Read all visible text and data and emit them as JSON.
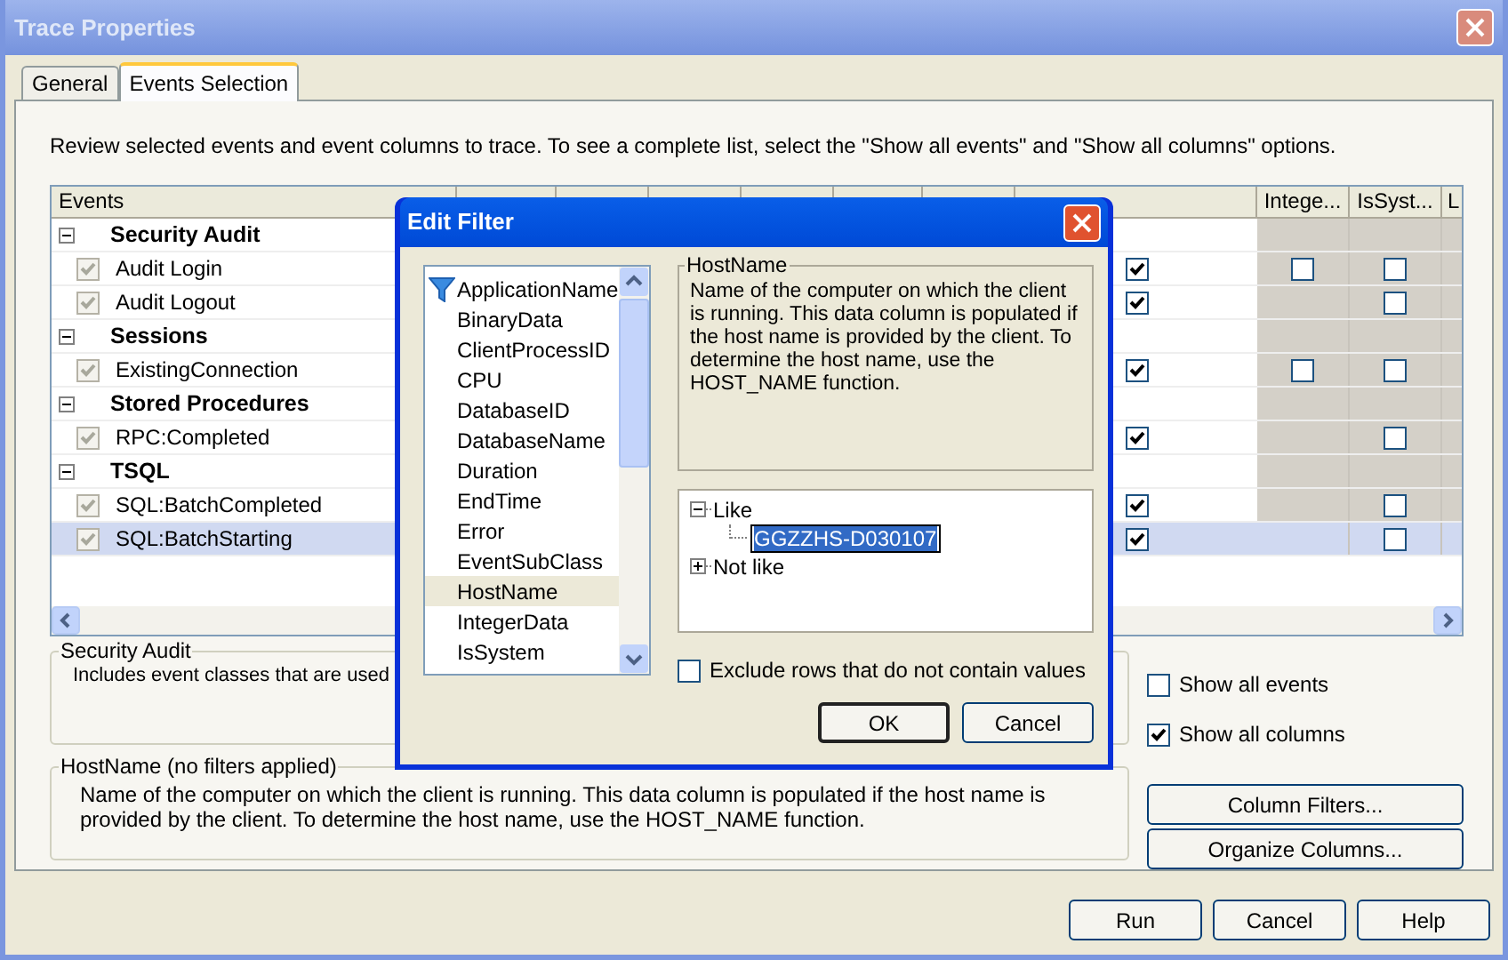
{
  "window": {
    "title": "Trace Properties"
  },
  "tabs": [
    {
      "label": "General",
      "selected": false
    },
    {
      "label": "Events Selection",
      "selected": true
    }
  ],
  "instructions": "Review selected events and event columns to trace. To see a complete list, select the \"Show all events\" and \"Show all columns\" options.",
  "grid": {
    "columns": [
      "Events",
      "Intege...",
      "IsSyst...",
      "L"
    ],
    "rows": [
      {
        "kind": "category",
        "label": "Security Audit",
        "expanded": true
      },
      {
        "kind": "event",
        "label": "Audit Login",
        "checked": true,
        "selected": false,
        "cells": [
          {
            "kind": "check",
            "checked": true
          },
          {
            "kind": "check",
            "checked": false
          },
          {
            "kind": "check",
            "checked": false
          }
        ]
      },
      {
        "kind": "event",
        "label": "Audit Logout",
        "checked": true,
        "selected": false,
        "cells": [
          {
            "kind": "check",
            "checked": true
          },
          {
            "kind": "none"
          },
          {
            "kind": "check",
            "checked": false
          }
        ]
      },
      {
        "kind": "category",
        "label": "Sessions",
        "expanded": true
      },
      {
        "kind": "event",
        "label": "ExistingConnection",
        "checked": true,
        "selected": false,
        "cells": [
          {
            "kind": "check",
            "checked": true
          },
          {
            "kind": "check",
            "checked": false
          },
          {
            "kind": "check",
            "checked": false
          }
        ]
      },
      {
        "kind": "category",
        "label": "Stored Procedures",
        "expanded": true
      },
      {
        "kind": "event",
        "label": "RPC:Completed",
        "checked": true,
        "selected": false,
        "cells": [
          {
            "kind": "check",
            "checked": true
          },
          {
            "kind": "none"
          },
          {
            "kind": "check",
            "checked": false
          }
        ]
      },
      {
        "kind": "category",
        "label": "TSQL",
        "expanded": true
      },
      {
        "kind": "event",
        "label": "SQL:BatchCompleted",
        "checked": true,
        "selected": false,
        "cells": [
          {
            "kind": "check",
            "checked": true
          },
          {
            "kind": "none"
          },
          {
            "kind": "check",
            "checked": false
          }
        ]
      },
      {
        "kind": "event",
        "label": "SQL:BatchStarting",
        "checked": true,
        "selected": true,
        "cells": [
          {
            "kind": "check",
            "checked": true
          },
          {
            "kind": "none"
          },
          {
            "kind": "check",
            "checked": false
          }
        ]
      }
    ]
  },
  "event_description": {
    "title": "Security Audit",
    "text": "Includes event classes that are used"
  },
  "options": [
    {
      "label": "Show all events",
      "checked": false
    },
    {
      "label": "Show all columns",
      "checked": true
    }
  ],
  "column_description": {
    "title": "HostName (no filters applied)",
    "text": "Name of the computer on which the client is running. This data column is populated if the host name is provided by the client. To determine the host name, use the HOST_NAME function."
  },
  "side_buttons": [
    "Column Filters...",
    "Organize Columns..."
  ],
  "buttons": [
    "Run",
    "Cancel",
    "Help"
  ],
  "dialog": {
    "title": "Edit Filter",
    "columns": [
      {
        "label": "ApplicationName",
        "filtered": true,
        "selected": false
      },
      {
        "label": "BinaryData",
        "filtered": false,
        "selected": false
      },
      {
        "label": "ClientProcessID",
        "filtered": false,
        "selected": false
      },
      {
        "label": "CPU",
        "filtered": false,
        "selected": false
      },
      {
        "label": "DatabaseID",
        "filtered": false,
        "selected": false
      },
      {
        "label": "DatabaseName",
        "filtered": false,
        "selected": false
      },
      {
        "label": "Duration",
        "filtered": false,
        "selected": false
      },
      {
        "label": "EndTime",
        "filtered": false,
        "selected": false
      },
      {
        "label": "Error",
        "filtered": false,
        "selected": false
      },
      {
        "label": "EventSubClass",
        "filtered": false,
        "selected": false
      },
      {
        "label": "HostName",
        "filtered": false,
        "selected": true
      },
      {
        "label": "IntegerData",
        "filtered": false,
        "selected": false
      },
      {
        "label": "IsSystem",
        "filtered": false,
        "selected": false
      }
    ],
    "description": {
      "title": "HostName",
      "text": "Name of the computer on which the client is running. This data column is populated if the host name is provided by the client. To determine the host name, use the HOST_NAME function."
    },
    "tree": [
      {
        "label": "Like",
        "expanded": true,
        "children": [
          {
            "label": "GGZZHS-D030107",
            "selected": true
          }
        ]
      },
      {
        "label": "Not like",
        "expanded": false
      }
    ],
    "exclude": {
      "label": "Exclude rows that do not contain values",
      "checked": false
    },
    "buttons": [
      "OK",
      "Cancel"
    ]
  }
}
